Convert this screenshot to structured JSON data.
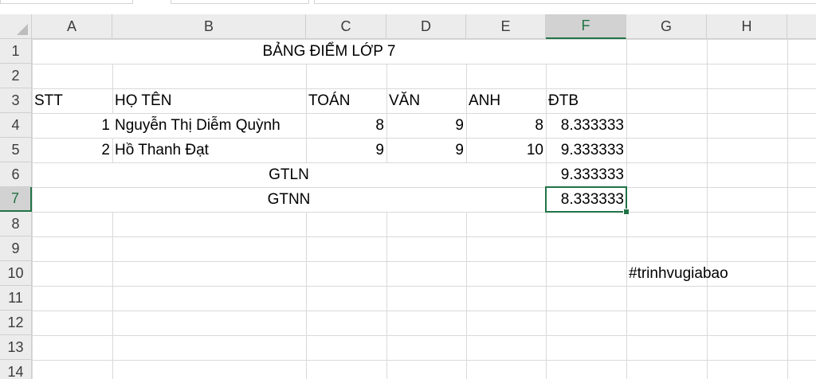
{
  "columns": [
    "A",
    "B",
    "C",
    "D",
    "E",
    "F",
    "G",
    "H"
  ],
  "rows": [
    "1",
    "2",
    "3",
    "4",
    "5",
    "6",
    "7",
    "8",
    "9",
    "10",
    "11",
    "12",
    "13",
    "14"
  ],
  "selected_column": "F",
  "selected_row": "7",
  "cells": {
    "title": "BẢNG ĐIỂM LỚP 7",
    "headers": {
      "stt": "STT",
      "ho_ten": "HỌ TÊN",
      "toan": "TOÁN",
      "van": "VĂN",
      "anh": "ANH",
      "dtb": "ĐTB"
    },
    "students": [
      {
        "stt": "1",
        "ho_ten": "Nguyễn Thị Diễm Quỳnh",
        "toan": "8",
        "van": "9",
        "anh": "8",
        "dtb": "8.333333"
      },
      {
        "stt": "2",
        "ho_ten": "Hồ Thanh Đạt",
        "toan": "9",
        "van": "9",
        "anh": "10",
        "dtb": "9.333333"
      }
    ],
    "gtln_label": "GTLN",
    "gtln_value": "9.333333",
    "gtnn_label": "GTNN",
    "gtnn_value": "8.333333",
    "hashtag": "#trinhvugiabao"
  },
  "colors": {
    "accent": "#217346",
    "gridline": "#d9d9d9",
    "header_bg": "#ececec"
  }
}
